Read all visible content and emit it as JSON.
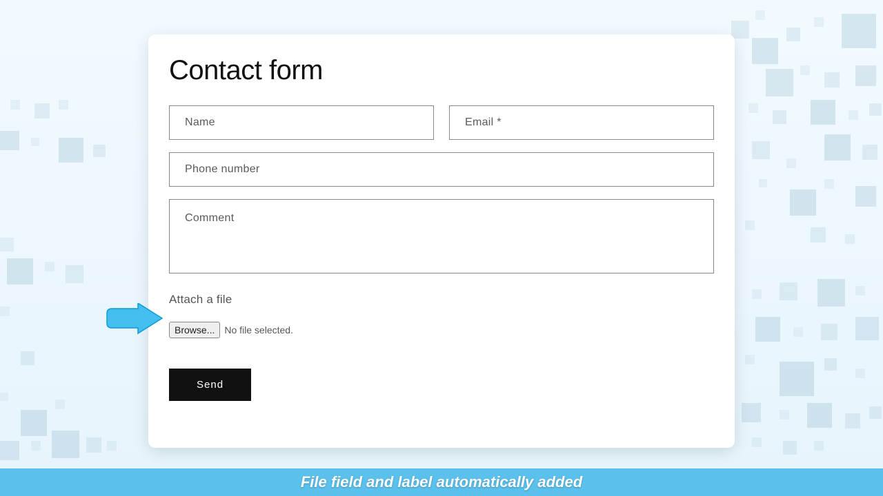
{
  "form": {
    "title": "Contact form",
    "name_placeholder": "Name",
    "email_placeholder": "Email *",
    "phone_placeholder": "Phone number",
    "comment_placeholder": "Comment",
    "attach_label": "Attach a file",
    "browse_label": "Browse...",
    "file_status": "No file selected.",
    "send_label": "Send"
  },
  "caption": "File field and label automatically added"
}
